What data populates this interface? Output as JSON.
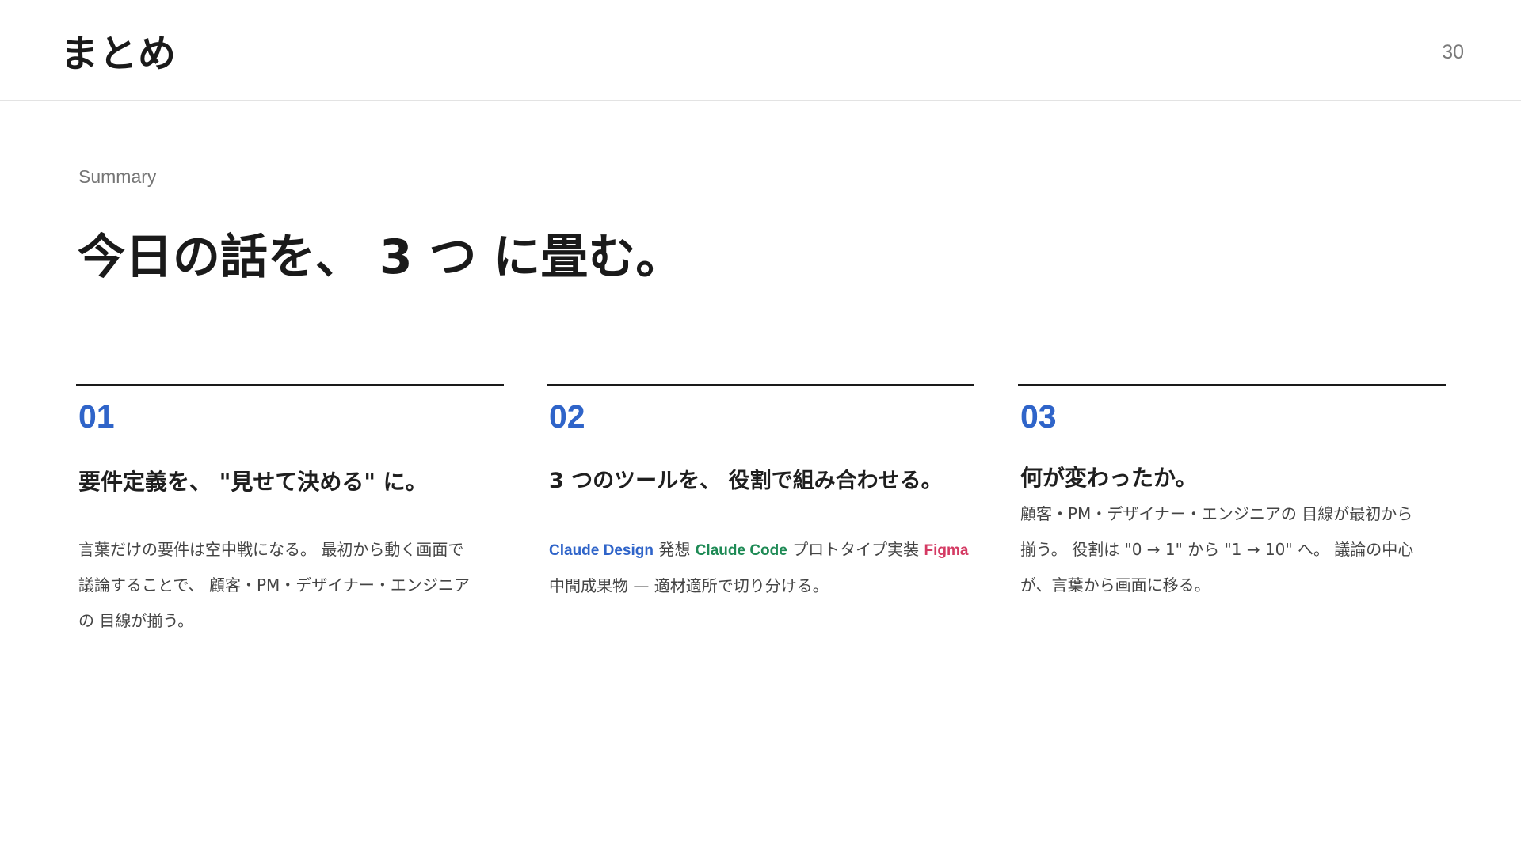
{
  "header": {
    "title": "まとめ",
    "page_number": "30"
  },
  "eyebrow": "Summary",
  "headline": "今日の話を、 3 つ に畳む。",
  "columns": [
    {
      "number": "01",
      "title": "要件定義を、 \"見せて決める\" に。",
      "body_lines": [
        "言葉だけの要件は空中戦になる。 最初から動く画面で",
        "議論することで、 顧客・PM・デザイナー・エンジニア",
        "の 目線が揃う。"
      ]
    },
    {
      "number": "02",
      "title": "3 つのツールを、 役割で組み合わせる。",
      "tools": [
        {
          "name": "Claude Design",
          "role": "発想",
          "color": "#2f64c9"
        },
        {
          "name": "Claude Code",
          "role": "プロトタイプ実装",
          "color": "#1e8a55"
        },
        {
          "name": "Figma",
          "role": "中間成果物",
          "color": "#d43a63"
        }
      ],
      "body_tail": "— 適材適所で切り分ける。"
    },
    {
      "number": "03",
      "title": "何が変わったか。",
      "body_lines": [
        "顧客・PM・デザイナー・エンジニアの 目線が最初から",
        "揃う。 役割は \"0 → 1\" から \"1 → 10\" へ。 議論の中心",
        "が、言葉から画面に移る。"
      ]
    }
  ],
  "colors": {
    "accent_blue": "#2f64c9",
    "accent_green": "#1e8a55",
    "accent_pink": "#d43a63",
    "text_dark": "#1a1a1a",
    "text_body": "#444444",
    "header_rule": "#e3e3e3"
  }
}
